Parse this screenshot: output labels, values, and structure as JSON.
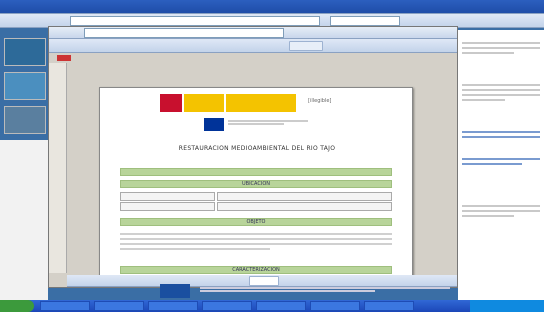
{
  "document": {
    "title": "RESTAURACION MEDIOAMBIENTAL DEL RIO TAJO",
    "sections": {
      "location": "UBICACION",
      "purpose": "OBJETO",
      "characterization": "CARACTERIZACION"
    },
    "ministry_line": "[illegible]"
  }
}
